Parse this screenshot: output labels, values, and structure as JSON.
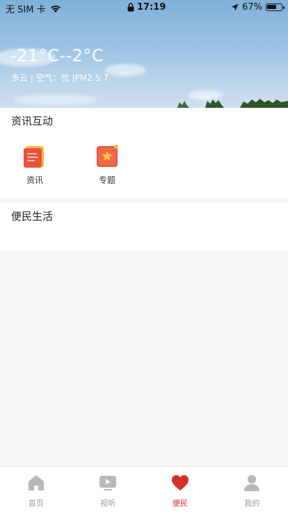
{
  "status_bar": {
    "carrier": "无 SIM 卡",
    "time": "17:19",
    "battery_percent": "67%",
    "battery_level": 0.67
  },
  "weather": {
    "temperature": "-21°C--2°C",
    "details": "多云 | 空气：优 |PM2.5:7"
  },
  "sections": {
    "info_interaction": {
      "title": "资讯互动",
      "items": [
        {
          "label": "资讯",
          "icon": "news-icon"
        },
        {
          "label": "专题",
          "icon": "topic-star-icon"
        }
      ]
    },
    "convenience": {
      "title": "便民生活"
    }
  },
  "tabbar": {
    "tabs": [
      {
        "label": "首页",
        "icon": "home-icon",
        "active": false
      },
      {
        "label": "视听",
        "icon": "video-icon",
        "active": false
      },
      {
        "label": "便民",
        "icon": "heart-icon",
        "active": true
      },
      {
        "label": "我的",
        "icon": "user-icon",
        "active": false
      }
    ]
  },
  "colors": {
    "accent": "#d4302b",
    "inactive": "#9a9a9a"
  }
}
